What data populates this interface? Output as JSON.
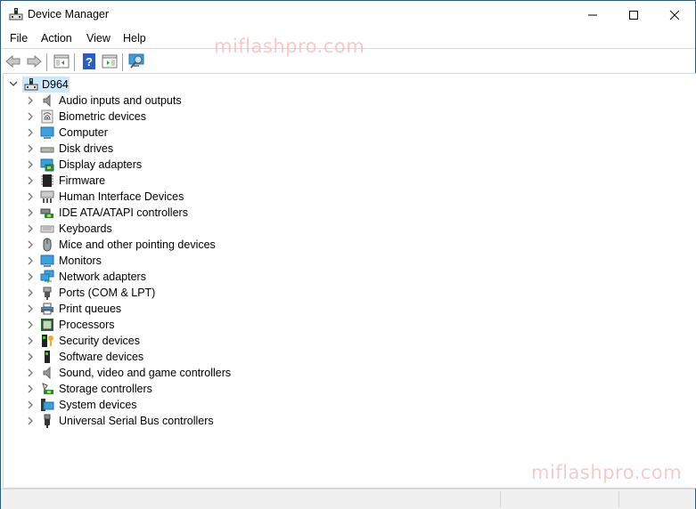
{
  "window": {
    "title": "Device Manager",
    "icon": "device-manager-icon",
    "controls": {
      "minimize": "minimize-icon",
      "maximize": "maximize-icon",
      "close": "close-icon"
    }
  },
  "menu": [
    "File",
    "Action",
    "View",
    "Help"
  ],
  "toolbar": {
    "buttons": [
      "back-arrow-icon",
      "forward-arrow-icon",
      "show-hide-console-tree-icon",
      "help-icon",
      "show-hide-action-pane-icon",
      "scan-hardware-changes-icon"
    ]
  },
  "tree": {
    "root": {
      "label": "D964",
      "expanded": true,
      "selected": true
    },
    "nodes": [
      {
        "label": "Audio inputs and outputs",
        "icon": "speaker-icon"
      },
      {
        "label": "Biometric devices",
        "icon": "fingerprint-icon"
      },
      {
        "label": "Computer",
        "icon": "computer-icon"
      },
      {
        "label": "Disk drives",
        "icon": "disk-drive-icon"
      },
      {
        "label": "Display adapters",
        "icon": "display-adapter-icon"
      },
      {
        "label": "Firmware",
        "icon": "firmware-chip-icon"
      },
      {
        "label": "Human Interface Devices",
        "icon": "hid-icon"
      },
      {
        "label": "IDE ATA/ATAPI controllers",
        "icon": "ide-controller-icon"
      },
      {
        "label": "Keyboards",
        "icon": "keyboard-icon"
      },
      {
        "label": "Mice and other pointing devices",
        "icon": "mouse-icon"
      },
      {
        "label": "Monitors",
        "icon": "monitor-icon"
      },
      {
        "label": "Network adapters",
        "icon": "network-adapter-icon"
      },
      {
        "label": "Ports (COM & LPT)",
        "icon": "port-icon"
      },
      {
        "label": "Print queues",
        "icon": "printer-icon"
      },
      {
        "label": "Processors",
        "icon": "processor-icon"
      },
      {
        "label": "Security devices",
        "icon": "security-device-icon"
      },
      {
        "label": "Software devices",
        "icon": "software-device-icon"
      },
      {
        "label": "Sound, video and game controllers",
        "icon": "speaker-icon"
      },
      {
        "label": "Storage controllers",
        "icon": "storage-controller-icon"
      },
      {
        "label": "System devices",
        "icon": "system-device-icon"
      },
      {
        "label": "Universal Serial Bus controllers",
        "icon": "usb-icon"
      }
    ]
  },
  "watermark": "miflashpro.com",
  "colors": {
    "selection": "#cce8ff",
    "border": "#2b5a7e",
    "watermark": "#f4b5b5"
  }
}
